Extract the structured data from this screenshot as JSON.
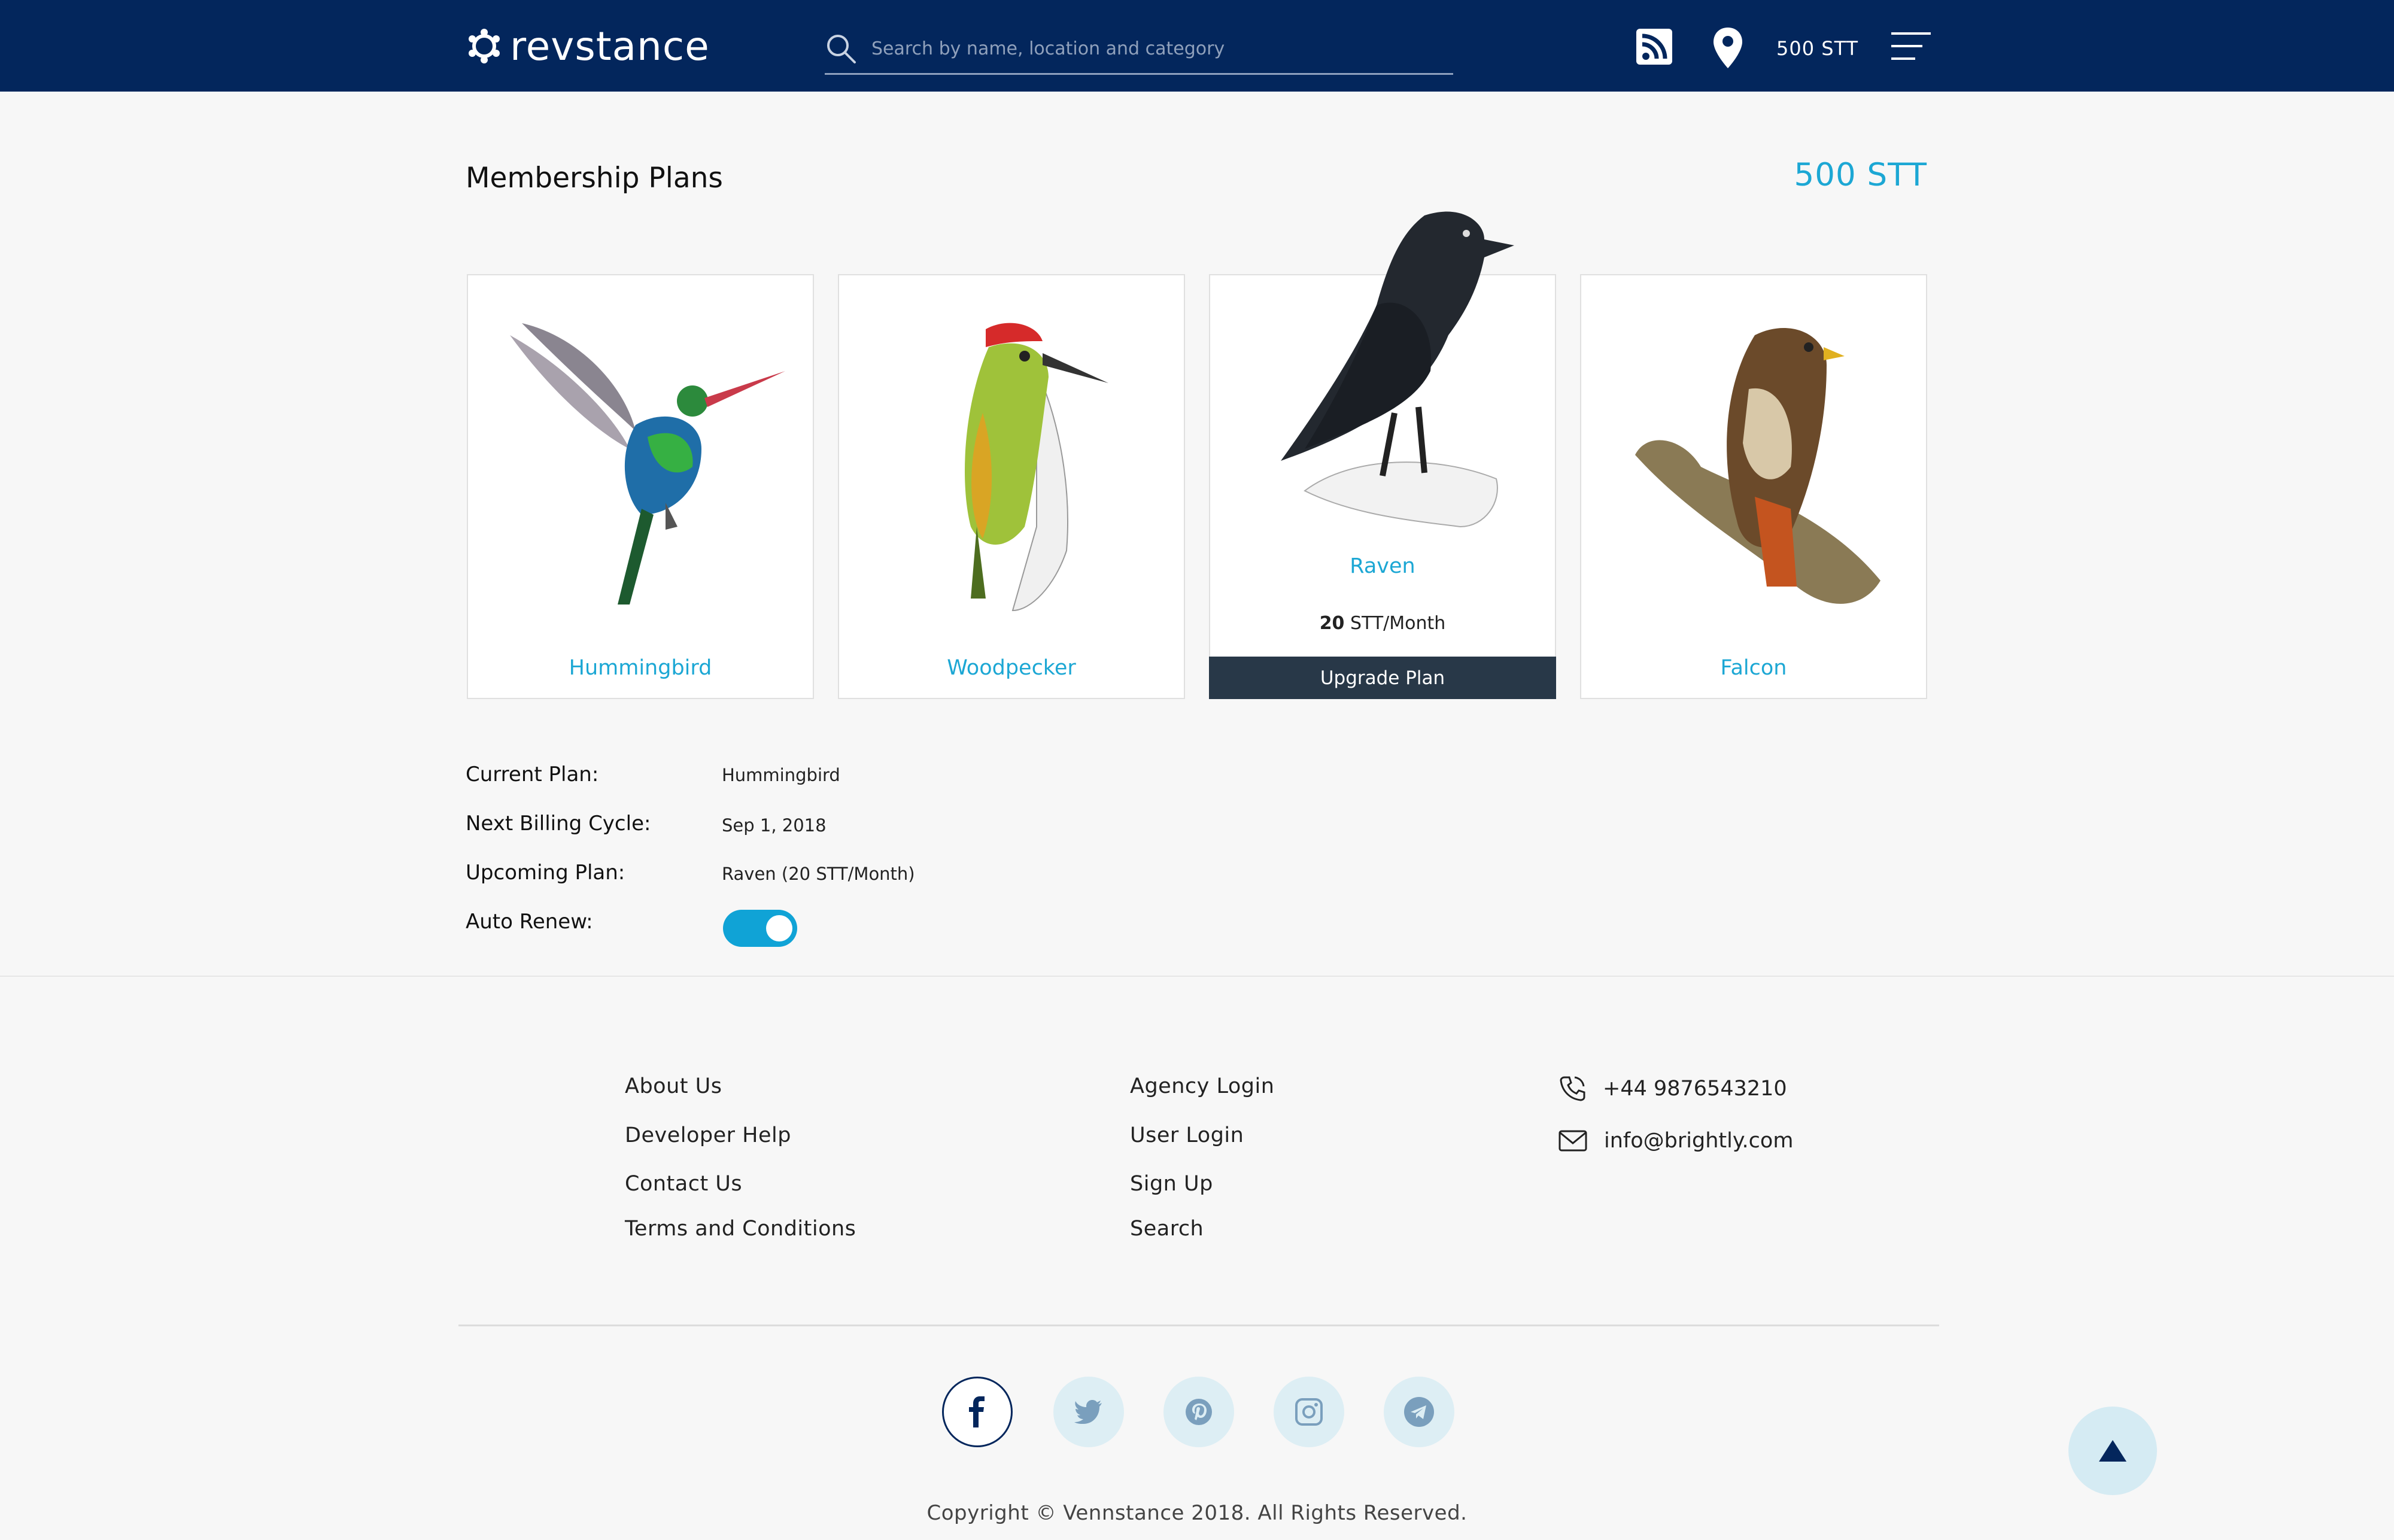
{
  "header": {
    "logo_text": "revstance",
    "search_placeholder": "Search by name, location and category",
    "balance": "500 STT",
    "icons": [
      "rss-icon",
      "location-pin-icon",
      "menu-icon"
    ]
  },
  "main": {
    "title": "Membership Plans",
    "balance": "500 STT",
    "plans": [
      {
        "name": "Hummingbird",
        "image": "hummingbird-image"
      },
      {
        "name": "Woodpecker",
        "image": "woodpecker-image"
      },
      {
        "name": "Raven",
        "image": "raven-image",
        "price_amount": "20",
        "price_unit": "STT/Month",
        "action": "Upgrade Plan"
      },
      {
        "name": "Falcon",
        "image": "falcon-image"
      }
    ],
    "info": {
      "current_plan_label": "Current Plan:",
      "current_plan_value": "Hummingbird",
      "next_billing_label": "Next Billing Cycle:",
      "next_billing_value": "Sep 1, 2018",
      "upcoming_plan_label": "Upcoming Plan:",
      "upcoming_plan_value": "Raven (20 STT/Month)",
      "auto_renew_label": "Auto Renew:",
      "auto_renew_on": true
    }
  },
  "footer": {
    "col1": [
      "About Us",
      "Developer Help",
      "Contact Us",
      "Terms and Conditions"
    ],
    "col2": [
      "Agency Login",
      "User Login",
      "Sign Up",
      "Search"
    ],
    "phone": "+44 9876543210",
    "email": "info@brightly.com",
    "social": [
      "facebook-icon",
      "twitter-icon",
      "pinterest-icon",
      "instagram-icon",
      "telegram-icon"
    ],
    "copyright": "Copyright © Vennstance 2018. All Rights Reserved."
  },
  "colors": {
    "header_bg": "#03265c",
    "accent": "#1ca7d4",
    "button_dark": "#283848"
  }
}
